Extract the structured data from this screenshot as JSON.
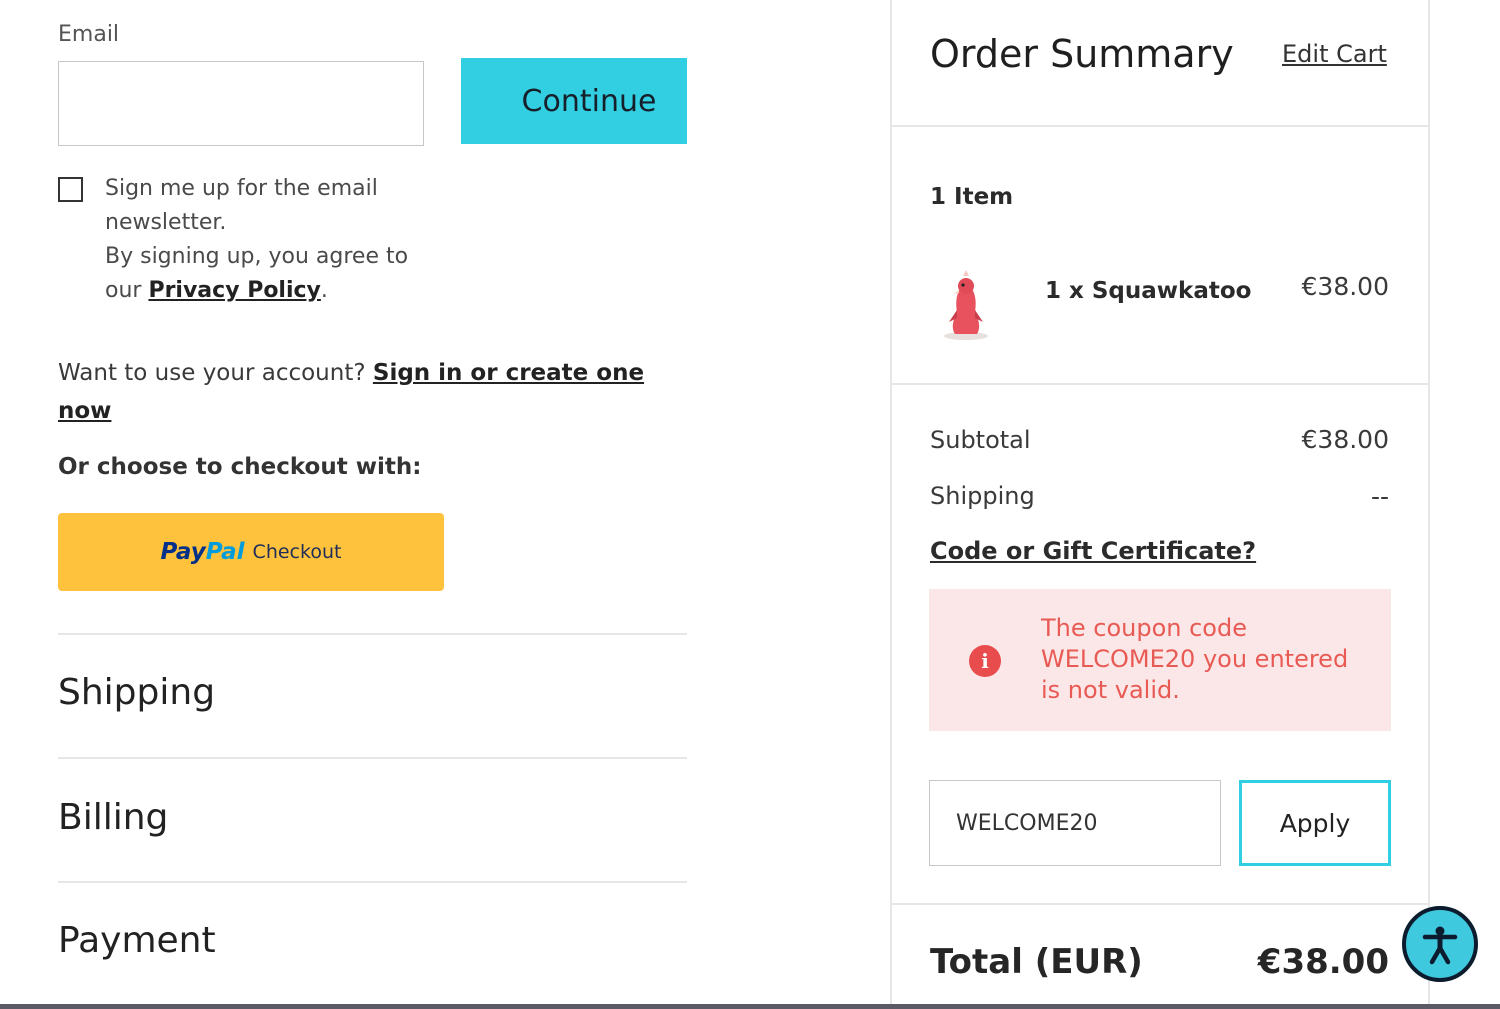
{
  "checkout": {
    "email_label": "Email",
    "email_value": "",
    "continue_label": "Continue",
    "newsletter_text": "Sign me up for the email newsletter.",
    "agree_text": "By signing up, you agree to our",
    "privacy_link": "Privacy Policy",
    "period": ".",
    "account_prompt": "Want to use your account?",
    "sign_in_link": "Sign in or create one now",
    "choose_text": "Or choose to checkout with:",
    "paypal_pay": "Pay",
    "paypal_pal": "Pal",
    "paypal_checkout": "Checkout",
    "sections": [
      "Shipping",
      "Billing",
      "Payment"
    ]
  },
  "summary": {
    "title": "Order Summary",
    "edit_cart": "Edit Cart",
    "item_count": "1 Item",
    "item": {
      "name": "1 x Squawkatoo",
      "price": "€38.00"
    },
    "subtotal_label": "Subtotal",
    "subtotal_value": "€38.00",
    "shipping_label": "Shipping",
    "shipping_value": "--",
    "coupon_link": "Code or Gift Certificate?",
    "error_icon": "i",
    "error_message": "The coupon code WELCOME20 you entered is not valid.",
    "coupon_value": "WELCOME20",
    "apply_label": "Apply",
    "total_label": "Total (EUR)",
    "total_value": "€38.00"
  },
  "colors": {
    "accent": "#32cfe2",
    "paypal": "#fec23c",
    "error_bg": "#fce7e8",
    "error_text": "#e85a54"
  },
  "icons": [
    "info-icon",
    "accessibility-icon",
    "checkbox-icon"
  ]
}
